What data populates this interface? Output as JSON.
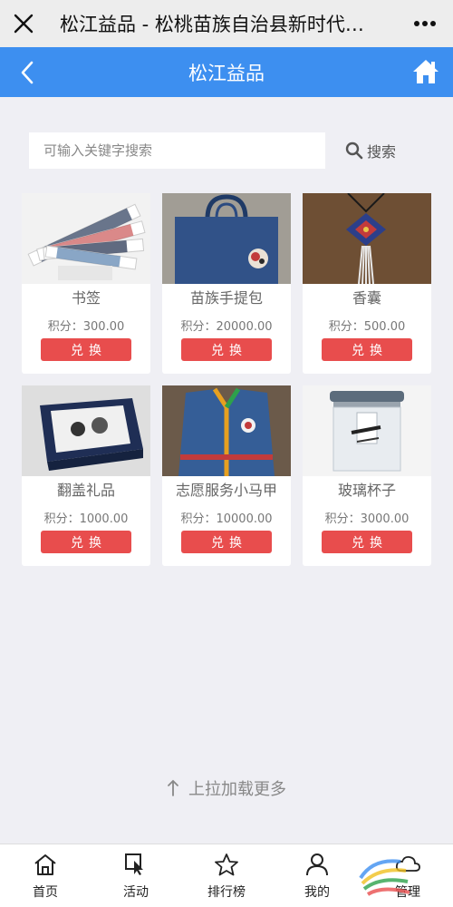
{
  "wechat_bar": {
    "title": "松江益品 - 松桃苗族自治县新时代…",
    "close_icon": "close-icon",
    "more_icon": "more-icon"
  },
  "header": {
    "title": "松江益品",
    "back_icon": "back-arrow-icon",
    "home_icon": "home-icon",
    "color": "#3d8ff0"
  },
  "search": {
    "placeholder": "可输入关键字搜索",
    "button_label": "搜索"
  },
  "products": [
    {
      "name": "书签",
      "points": "积分：300.00",
      "button": "兑换"
    },
    {
      "name": "苗族手提包",
      "points": "积分：20000.00",
      "button": "兑换"
    },
    {
      "name": "香囊",
      "points": "积分：500.00",
      "button": "兑换"
    },
    {
      "name": "翻盖礼品",
      "points": "积分：1000.00",
      "button": "兑换"
    },
    {
      "name": "志愿服务小马甲",
      "points": "积分：10000.00",
      "button": "兑换"
    },
    {
      "name": "玻璃杯子",
      "points": "积分：3000.00",
      "button": "兑换"
    }
  ],
  "load_more": "上拉加载更多",
  "tabbar": {
    "items": [
      {
        "label": "首页",
        "icon": "home-icon"
      },
      {
        "label": "活动",
        "icon": "cursor-icon"
      },
      {
        "label": "排行榜",
        "icon": "star-icon"
      },
      {
        "label": "我的",
        "icon": "user-icon"
      },
      {
        "label": "管理",
        "icon": "cloud-icon"
      }
    ]
  },
  "colors": {
    "accent": "#3d8ff0",
    "button": "#e84d4d",
    "background": "#efeff4"
  }
}
